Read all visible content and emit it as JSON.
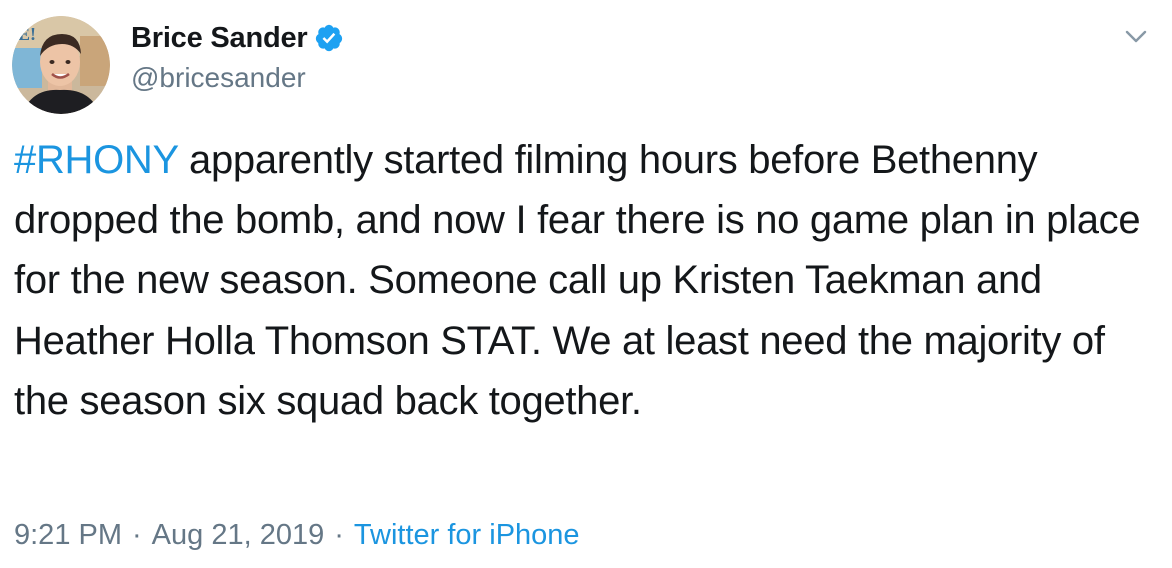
{
  "author": {
    "display_name": "Brice Sander",
    "handle": "@bricesander",
    "verified": true,
    "avatar_icon": "avatar-photo",
    "avatar_logo_text": "E!"
  },
  "menu": {
    "icon": "chevron-down-icon"
  },
  "tweet": {
    "hashtag": "#RHONY",
    "text": " apparently started filming hours before Bethenny dropped the bomb, and now I fear there is no game plan in place for the new season. Someone call up Kristen Taekman and Heather Holla Thomson STAT. We at least need the majority of the season six squad back together."
  },
  "meta": {
    "time": "9:21 PM",
    "separator": "·",
    "date": "Aug 21, 2019",
    "source": "Twitter for iPhone"
  },
  "colors": {
    "link": "#1b95e0",
    "secondary_text": "#657786",
    "primary_text": "#14171a",
    "verified_badge": "#1da1f2"
  }
}
